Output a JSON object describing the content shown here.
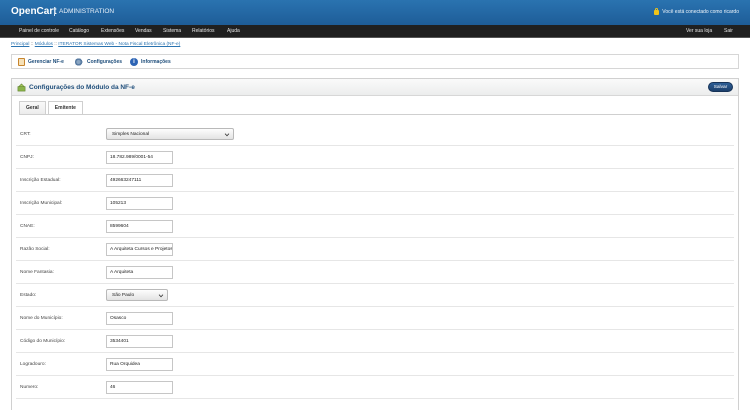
{
  "header": {
    "brand": "OpenCart",
    "subtitle": "ADMINISTRATION",
    "logged_in": "Você está conectado como ricardo"
  },
  "menu": {
    "left": [
      "Painel de controle",
      "Catálogo",
      "Extensões",
      "Vendas",
      "Sistema",
      "Relatórios",
      "Ajuda"
    ],
    "right": [
      "Ver sua loja",
      "Sair"
    ]
  },
  "breadcrumb": [
    "Principal",
    "Módulos",
    "ITERATOR Sistemas Web - Nota Fiscal Eletrônica (NF-e)"
  ],
  "toolbar": {
    "manage": "Gerenciar NF-e",
    "settings": "Configurações",
    "info": "Informações"
  },
  "panel": {
    "title": "Configurações do Módulo da NF-e",
    "save": "Salvar"
  },
  "tabs": [
    "Geral",
    "Emitente"
  ],
  "form": {
    "crt": {
      "label": "CRT:",
      "value": "Simples Nacional"
    },
    "cnpj": {
      "label": "CNPJ:",
      "value": "18.782.989/0001-54"
    },
    "ie": {
      "label": "Inscrição Estadual:",
      "value": "492663247111"
    },
    "im": {
      "label": "Inscrição Municipal:",
      "value": "105213"
    },
    "cnae": {
      "label": "CNAE:",
      "value": "8599604"
    },
    "razao": {
      "label": "Razão Social:",
      "value": "A Arquiteta Cursos e Projetos"
    },
    "fantasia": {
      "label": "Nome Fantasia:",
      "value": "A Arquiteta"
    },
    "estado": {
      "label": "Estado:",
      "value": "São Paulo"
    },
    "municipio": {
      "label": "Nome do Município:",
      "value": "Osasco"
    },
    "cod_municipio": {
      "label": "Código do Município:",
      "value": "3534401"
    },
    "logradouro": {
      "label": "Logradouro:",
      "value": "Rua Orquidea"
    },
    "numero": {
      "label": "Numero:",
      "value": "46"
    }
  }
}
